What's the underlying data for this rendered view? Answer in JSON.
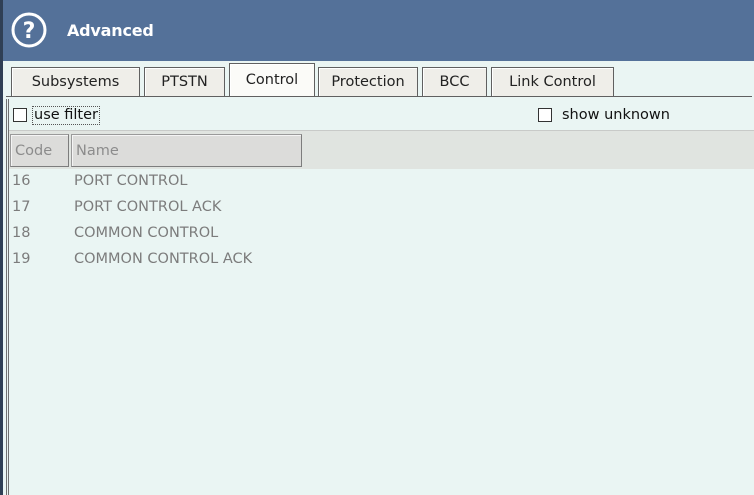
{
  "window": {
    "title": "Advanced",
    "help_icon": "question-circle-icon"
  },
  "tabs": [
    {
      "label": "Subsystems",
      "active": false
    },
    {
      "label": "PTSTN",
      "active": false
    },
    {
      "label": "Control",
      "active": true
    },
    {
      "label": "Protection",
      "active": false
    },
    {
      "label": "BCC",
      "active": false
    },
    {
      "label": "Link Control",
      "active": false
    }
  ],
  "filter": {
    "use_filter_label": "use filter",
    "use_filter_checked": false,
    "show_unknown_label": "show unknown",
    "show_unknown_checked": false
  },
  "table": {
    "columns": [
      "Code",
      "Name"
    ],
    "rows": [
      {
        "code": "16",
        "name": "PORT CONTROL"
      },
      {
        "code": "17",
        "name": "PORT CONTROL ACK"
      },
      {
        "code": "18",
        "name": "COMMON CONTROL"
      },
      {
        "code": "19",
        "name": "COMMON CONTROL ACK"
      }
    ]
  },
  "colors": {
    "titlebar": "#547199",
    "background": "#eaf5f3"
  }
}
